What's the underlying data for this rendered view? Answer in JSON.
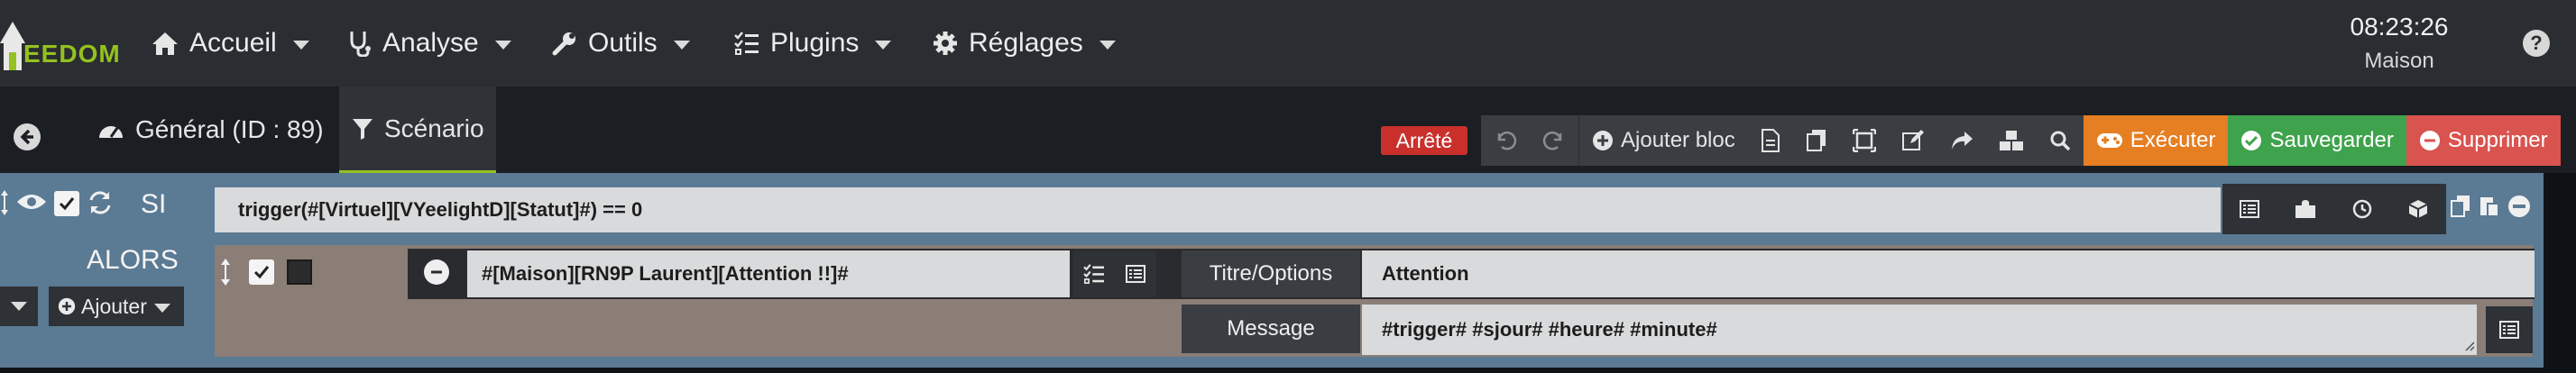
{
  "app": {
    "logo_text": "EEDOM",
    "brand_color": "#94c11f"
  },
  "nav": [
    {
      "label": "Accueil",
      "icon": "home-icon"
    },
    {
      "label": "Analyse",
      "icon": "stethoscope-icon"
    },
    {
      "label": "Outils",
      "icon": "wrench-icon"
    },
    {
      "label": "Plugins",
      "icon": "tasks-icon"
    },
    {
      "label": "Réglages",
      "icon": "gear-icon"
    }
  ],
  "clock": {
    "time": "08:23:26",
    "place": "Maison"
  },
  "tabs": [
    {
      "label": "Général (ID : 89)",
      "icon": "dashboard-icon"
    },
    {
      "label": "Scénario",
      "icon": "filter-icon",
      "active": true
    }
  ],
  "status": {
    "label": "Arrêté",
    "color": "#c9302c"
  },
  "toolbar": {
    "add_block": "Ajouter bloc",
    "run": "Exécuter",
    "save": "Sauvegarder",
    "delete": "Supprimer",
    "run_color": "#e67e22",
    "save_color": "#3fa34d",
    "delete_color": "#d9534f"
  },
  "block": {
    "si_label": "SI",
    "alors_label": "ALORS",
    "condition": "trigger(#[Virtuel][VYeelightD][Statut]#)  == 0",
    "add_label": "Ajouter",
    "action": {
      "command": "#[Maison][RN9P Laurent][Attention !!]#",
      "title_label": "Titre/Options",
      "title_value": "Attention",
      "message_label": "Message",
      "message_value": "#trigger# #sjour# #heure# #minute#"
    }
  }
}
